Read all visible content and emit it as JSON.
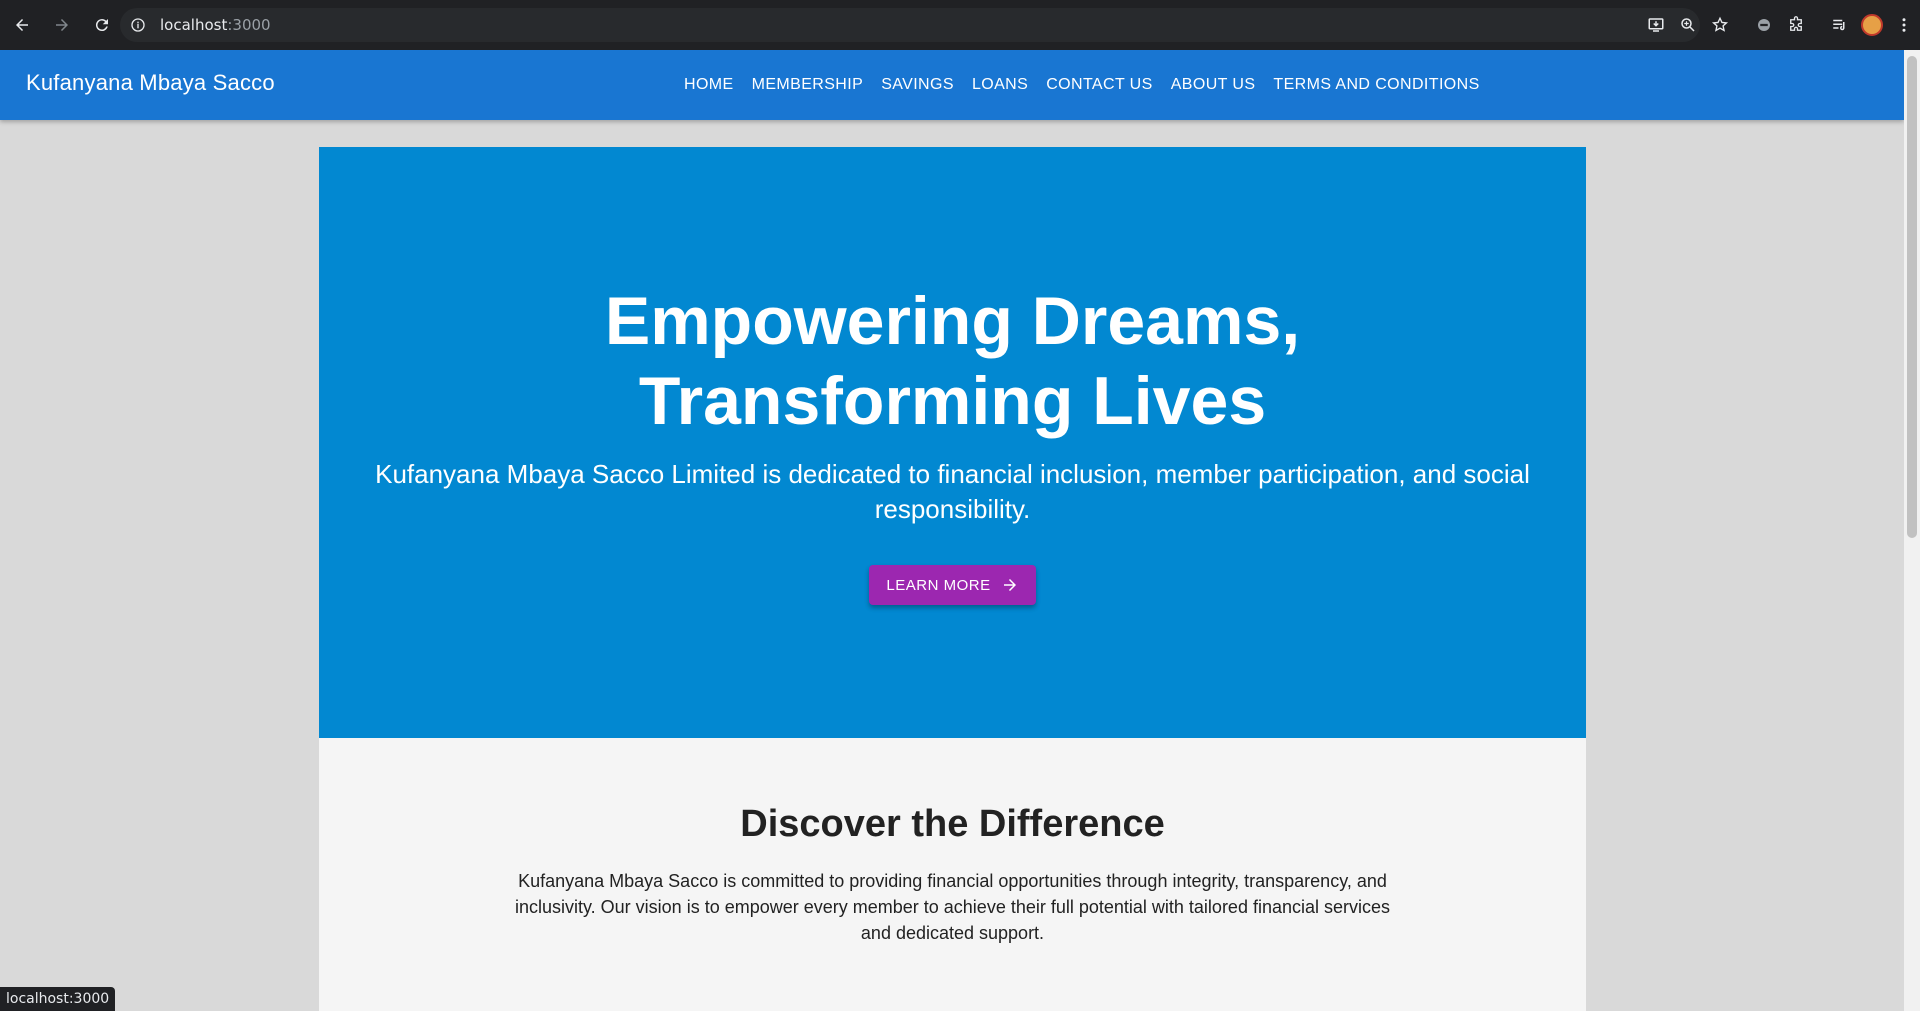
{
  "browser": {
    "url_host": "localhost",
    "url_port": ":3000",
    "status_text": "localhost:3000"
  },
  "appbar": {
    "brand": "Kufanyana Mbaya Sacco",
    "nav": [
      "HOME",
      "MEMBERSHIP",
      "SAVINGS",
      "LOANS",
      "CONTACT US",
      "ABOUT US",
      "TERMS AND CONDITIONS"
    ]
  },
  "hero": {
    "title": "Empowering Dreams, Transforming Lives",
    "subtitle": "Kufanyana Mbaya Sacco Limited is dedicated to financial inclusion, member participation, and social responsibility.",
    "cta_label": "LEARN MORE",
    "cta_icon": "arrow-right-icon"
  },
  "discover": {
    "title": "Discover the Difference",
    "body": "Kufanyana Mbaya Sacco is committed to providing financial opportunities through integrity, transparency, and inclusivity. Our vision is to empower every member to achieve their full potential with tailored financial services and dedicated support."
  },
  "colors": {
    "appbar": "#1976d2",
    "hero": "#0288d1",
    "cta": "#9c27b0",
    "section": "#f5f5f5"
  }
}
